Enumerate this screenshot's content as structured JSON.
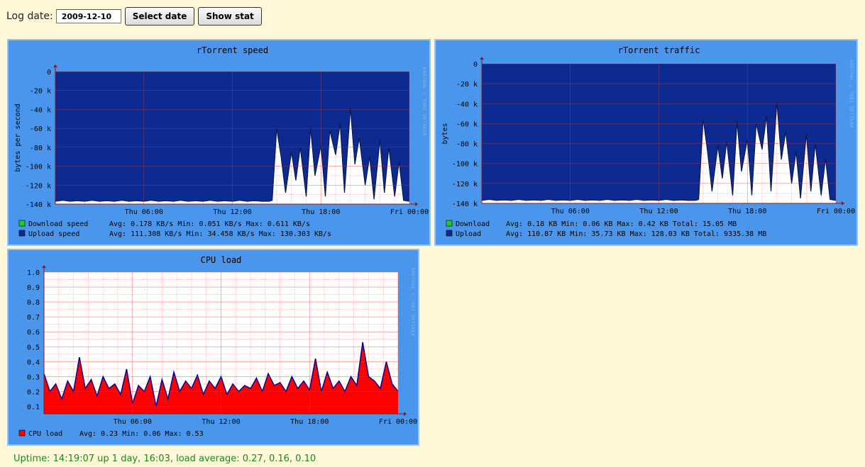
{
  "form": {
    "label": "Log date:",
    "date_value": "2009-12-10",
    "select_label": "Select date",
    "show_label": "Show stat"
  },
  "watermark": "RRDTOOL / TOBI OETIKER",
  "colors": {
    "panel": "#4a96ec",
    "plot_blue": "#0c2a90",
    "cpu_red": "#ff0000",
    "cpu_line": "#000096",
    "grid": "#f0a0a0",
    "download_swatch": "#22cc22"
  },
  "chart_data": [
    {
      "id": "speed",
      "type": "area",
      "title": "rTorrent speed",
      "ylabel": "bytes per second",
      "ylim": [
        -140000,
        0
      ],
      "yticks": [
        0,
        -20000,
        -40000,
        -60000,
        -80000,
        -100000,
        -120000,
        -140000
      ],
      "ytick_labels": [
        "0",
        "-20 k",
        "-40 k",
        "-60 k",
        "-80 k",
        "-100 k",
        "-120 k",
        "-140 k"
      ],
      "xlim": [
        0,
        24
      ],
      "xticks": [
        6,
        12,
        18,
        24
      ],
      "xtick_labels": [
        "Thu 06:00",
        "Thu 12:00",
        "Thu 18:00",
        "Fri 00:00"
      ],
      "x": [
        0,
        0.5,
        1,
        1.5,
        2,
        2.5,
        3,
        3.5,
        4,
        4.5,
        5,
        5.5,
        6,
        6.5,
        7,
        7.5,
        8,
        8.5,
        9,
        9.5,
        10,
        10.5,
        11,
        11.5,
        12,
        12.5,
        13,
        13.5,
        14,
        14.5,
        14.7,
        15,
        15.3,
        15.6,
        16,
        16.3,
        16.6,
        17,
        17.3,
        17.6,
        18,
        18.3,
        18.6,
        19,
        19.3,
        19.6,
        20,
        20.3,
        20.6,
        21,
        21.3,
        21.6,
        22,
        22.3,
        22.6,
        23,
        23.3,
        23.6,
        24
      ],
      "series": [
        {
          "name": "Download speed",
          "values": [
            -200,
            -200,
            -200,
            -200,
            -200,
            -200,
            -200,
            -200,
            -200,
            -200,
            -200,
            -200,
            -200,
            -200,
            -200,
            -200,
            -200,
            -200,
            -200,
            -200,
            -200,
            -200,
            -200,
            -200,
            -200,
            -200,
            -200,
            -200,
            -200,
            -200,
            -200,
            -200,
            -200,
            -200,
            -200,
            -200,
            -200,
            -200,
            -200,
            -200,
            -200,
            -200,
            -200,
            -200,
            -200,
            -200,
            -200,
            -200,
            -200,
            -200,
            -200,
            -200,
            -200,
            -200,
            -200,
            -200,
            -200,
            -200,
            -200
          ]
        },
        {
          "name": "Upload speed",
          "values": [
            -137000,
            -136000,
            -137000,
            -136500,
            -137000,
            -136000,
            -137000,
            -136500,
            -137000,
            -136000,
            -137000,
            -136500,
            -137000,
            -136000,
            -137000,
            -136500,
            -137000,
            -136000,
            -137000,
            -136500,
            -137000,
            -136000,
            -137000,
            -136500,
            -137000,
            -136000,
            -137000,
            -136500,
            -137000,
            -137000,
            -136000,
            -60000,
            -90000,
            -128000,
            -85000,
            -115000,
            -80000,
            -132000,
            -60000,
            -110000,
            -78000,
            -132000,
            -62000,
            -88000,
            -55000,
            -128000,
            -38000,
            -98000,
            -70000,
            -120000,
            -90000,
            -135000,
            -72000,
            -128000,
            -80000,
            -132000,
            -95000,
            -136000,
            -137000
          ]
        }
      ],
      "legend": [
        {
          "name": "Download speed",
          "color": "#22cc22",
          "text": "Avg:   0.178 KB/s   Min:   0.051 KB/s   Max:   0.611 KB/s"
        },
        {
          "name": "Upload speed",
          "color": "#0c2a90",
          "text": "Avg: 111.308 KB/s   Min:  34.458 KB/s   Max: 130.303 KB/s"
        }
      ]
    },
    {
      "id": "traffic",
      "type": "area",
      "title": "rTorrent traffic",
      "ylabel": "bytes",
      "ylim": [
        -140000,
        0
      ],
      "yticks": [
        0,
        -20000,
        -40000,
        -60000,
        -80000,
        -100000,
        -120000,
        -140000
      ],
      "ytick_labels": [
        "0",
        "-20 k",
        "-40 k",
        "-60 k",
        "-80 k",
        "-100 k",
        "-120 k",
        "-140 k"
      ],
      "xlim": [
        0,
        24
      ],
      "xticks": [
        6,
        12,
        18,
        24
      ],
      "xtick_labels": [
        "Thu 06:00",
        "Thu 12:00",
        "Thu 18:00",
        "Fri 00:00"
      ],
      "x": [
        0,
        0.5,
        1,
        1.5,
        2,
        2.5,
        3,
        3.5,
        4,
        4.5,
        5,
        5.5,
        6,
        6.5,
        7,
        7.5,
        8,
        8.5,
        9,
        9.5,
        10,
        10.5,
        11,
        11.5,
        12,
        12.5,
        13,
        13.5,
        14,
        14.5,
        14.7,
        15,
        15.3,
        15.6,
        16,
        16.3,
        16.6,
        17,
        17.3,
        17.6,
        18,
        18.3,
        18.6,
        19,
        19.3,
        19.6,
        20,
        20.3,
        20.6,
        21,
        21.3,
        21.6,
        22,
        22.3,
        22.6,
        23,
        23.3,
        23.6,
        24
      ],
      "series": [
        {
          "name": "Download",
          "values": [
            -200,
            -200,
            -200,
            -200,
            -200,
            -200,
            -200,
            -200,
            -200,
            -200,
            -200,
            -200,
            -200,
            -200,
            -200,
            -200,
            -200,
            -200,
            -200,
            -200,
            -200,
            -200,
            -200,
            -200,
            -200,
            -200,
            -200,
            -200,
            -200,
            -200,
            -200,
            -200,
            -200,
            -200,
            -200,
            -200,
            -200,
            -200,
            -200,
            -200,
            -200,
            -200,
            -200,
            -200,
            -200,
            -200,
            -200,
            -200,
            -200,
            -200,
            -200,
            -200,
            -200,
            -200,
            -200,
            -200,
            -200,
            -200,
            -200
          ]
        },
        {
          "name": "Upload",
          "values": [
            -137000,
            -136000,
            -137000,
            -136500,
            -137000,
            -136000,
            -137000,
            -136500,
            -137000,
            -136000,
            -137000,
            -136500,
            -137000,
            -136000,
            -137000,
            -136500,
            -137000,
            -136000,
            -137000,
            -136500,
            -137000,
            -136000,
            -137000,
            -136500,
            -137000,
            -136000,
            -137000,
            -136500,
            -137000,
            -137000,
            -136000,
            -55000,
            -88000,
            -128000,
            -82000,
            -115000,
            -78000,
            -132000,
            -58000,
            -108000,
            -76000,
            -132000,
            -60000,
            -86000,
            -52000,
            -128000,
            -38000,
            -96000,
            -68000,
            -120000,
            -88000,
            -135000,
            -70000,
            -128000,
            -80000,
            -132000,
            -95000,
            -136000,
            -137000
          ]
        }
      ],
      "legend": [
        {
          "name": "Download",
          "color": "#22cc22",
          "text": "Avg:   0.18 KB   Min:   0.06 KB   Max:   0.42 KB   Total:    15.05 MB"
        },
        {
          "name": "Upload",
          "color": "#0c2a90",
          "text": "Avg: 110.87 KB   Min:  35.73 KB   Max: 128.03 KB   Total:  9335.38 MB"
        }
      ]
    },
    {
      "id": "cpu",
      "type": "area",
      "title": "CPU load",
      "ylabel": "",
      "ylim": [
        0.05,
        1.0
      ],
      "yticks": [
        0.1,
        0.2,
        0.3,
        0.4,
        0.5,
        0.6,
        0.7,
        0.8,
        0.9,
        1.0
      ],
      "ytick_labels": [
        "0.1",
        "0.2",
        "0.3",
        "0.4",
        "0.5",
        "0.6",
        "0.7",
        "0.8",
        "0.9",
        "1.0"
      ],
      "xlim": [
        0,
        24
      ],
      "xticks": [
        6,
        12,
        18,
        24
      ],
      "xtick_labels": [
        "Thu 06:00",
        "Thu 12:00",
        "Thu 18:00",
        "Fri 00:00"
      ],
      "x": [
        0,
        0.4,
        0.8,
        1.2,
        1.6,
        2,
        2.4,
        2.8,
        3.2,
        3.6,
        4,
        4.4,
        4.8,
        5.2,
        5.6,
        6,
        6.4,
        6.8,
        7.2,
        7.6,
        8,
        8.4,
        8.8,
        9.2,
        9.6,
        10,
        10.4,
        10.8,
        11.2,
        11.6,
        12,
        12.4,
        12.8,
        13.2,
        13.6,
        14,
        14.4,
        14.8,
        15.2,
        15.6,
        16,
        16.4,
        16.8,
        17.2,
        17.6,
        18,
        18.4,
        18.8,
        19.2,
        19.6,
        20,
        20.4,
        20.8,
        21.2,
        21.6,
        22,
        22.4,
        22.8,
        23.2,
        23.6,
        24
      ],
      "series": [
        {
          "name": "CPU load",
          "values": [
            0.32,
            0.2,
            0.25,
            0.15,
            0.27,
            0.2,
            0.43,
            0.22,
            0.28,
            0.17,
            0.3,
            0.22,
            0.25,
            0.18,
            0.35,
            0.12,
            0.24,
            0.2,
            0.3,
            0.1,
            0.28,
            0.15,
            0.33,
            0.2,
            0.27,
            0.22,
            0.31,
            0.18,
            0.27,
            0.22,
            0.3,
            0.18,
            0.25,
            0.2,
            0.24,
            0.22,
            0.29,
            0.2,
            0.32,
            0.24,
            0.26,
            0.2,
            0.3,
            0.22,
            0.27,
            0.21,
            0.42,
            0.2,
            0.33,
            0.22,
            0.27,
            0.2,
            0.3,
            0.24,
            0.53,
            0.3,
            0.27,
            0.22,
            0.4,
            0.25,
            0.2
          ]
        }
      ],
      "legend": [
        {
          "name": "CPU load",
          "color": "#ff0000",
          "text": "Avg: 0.23   Min: 0.06   Max: 0.53"
        }
      ]
    }
  ],
  "uptime": "Uptime: 14:19:07 up 1 day, 16:03, load average: 0.27, 0.16, 0.10"
}
